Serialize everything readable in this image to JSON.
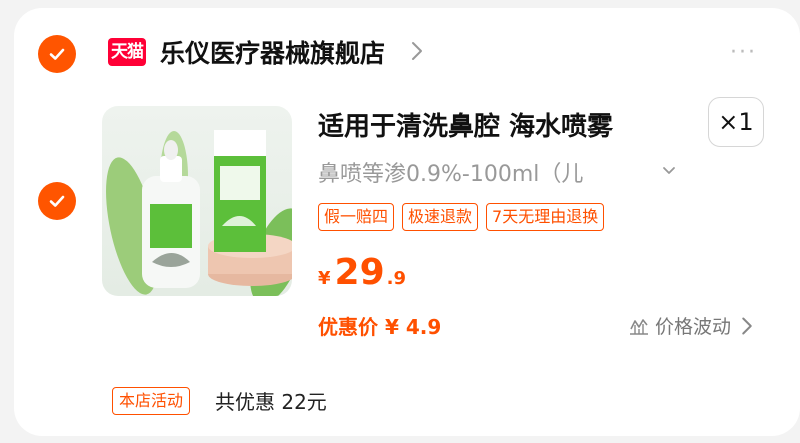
{
  "shop": {
    "badge": "天猫",
    "name": "乐仪医疗器械旗舰店",
    "more": "···"
  },
  "product": {
    "title": "适用于清洗鼻腔 海水喷雾",
    "quantity": "×1",
    "sku": "鼻喷等渗0.9%-100ml（儿",
    "tags": [
      "假一赔四",
      "极速退款",
      "7天无理由退换"
    ],
    "price": {
      "currency": "¥",
      "integer": "29",
      "decimal": ".9"
    },
    "discount_price": "优惠价 ¥ 4.9",
    "price_trend_label": "价格波动",
    "image_name": "nasal-spray-product-image"
  },
  "promotion": {
    "tag": "本店活动",
    "text": "共优惠 22元"
  },
  "colors": {
    "accent": "#ff5000",
    "tmall_red": "#ff0036",
    "card_bg": "#ffffff",
    "page_bg": "#f3f3f3"
  }
}
